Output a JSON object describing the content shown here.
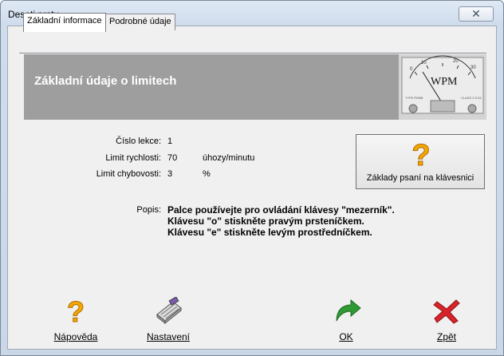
{
  "window": {
    "title": "Deseti prsty"
  },
  "tabs": [
    {
      "label": "Základní informace",
      "active": true
    },
    {
      "label": "Podrobné údaje",
      "active": false
    }
  ],
  "header": {
    "title": "Základní údaje o limitech",
    "meter_label": "WPM"
  },
  "fields": {
    "lesson": {
      "label": "Číslo lekce:",
      "value": "1"
    },
    "speed": {
      "label": "Limit rychlosti:",
      "value": "70",
      "unit": "úhozy/minutu"
    },
    "errors": {
      "label": "Limit chybovosti:",
      "value": "3",
      "unit": "%"
    }
  },
  "basics_button": {
    "label": "Základy psaní na klávesnici",
    "icon": "question-mark-icon"
  },
  "description": {
    "label": "Popis:",
    "lines": [
      "Palce používejte pro ovládání klávesy \"mezerník\".",
      "Klávesu \"o\" stiskněte pravým prsteníčkem.",
      "Klávesu \"e\" stiskněte levým prostředníčkem."
    ]
  },
  "buttons": {
    "help": {
      "label": "Nápověda",
      "icon": "question-mark-icon"
    },
    "settings": {
      "label": "Nastavení",
      "icon": "keyboard-icon"
    },
    "ok": {
      "label": "OK",
      "icon": "green-arrow-icon"
    },
    "back": {
      "label": "Zpět",
      "icon": "red-x-icon"
    }
  },
  "colors": {
    "header_band": "#9e9e9e",
    "question_mark": "#f5a800",
    "ok_arrow": "#2f9a35",
    "back_x": "#d8232a"
  }
}
